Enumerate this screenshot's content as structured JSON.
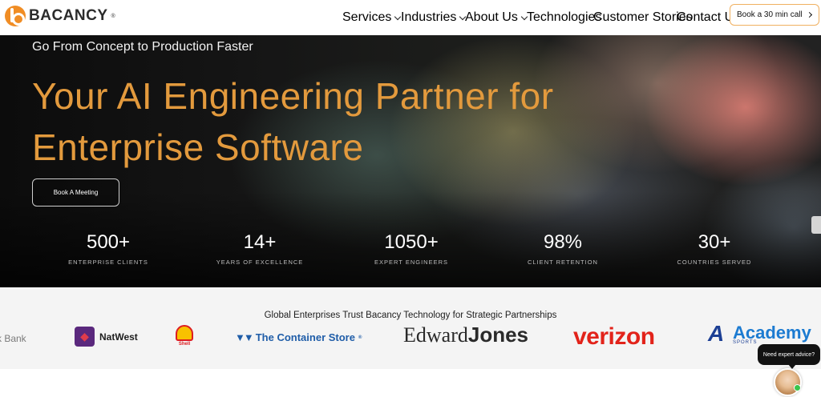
{
  "brand": {
    "name": "BACANCY",
    "registered_mark": "®",
    "accent_color": "#f08d25"
  },
  "nav": {
    "items": [
      {
        "label": "Services",
        "has_dropdown": true
      },
      {
        "label": "Industries",
        "has_dropdown": true
      },
      {
        "label": "About Us",
        "has_dropdown": true
      },
      {
        "label": "Technologies",
        "has_dropdown": false
      },
      {
        "label": "Customer Stories",
        "has_dropdown": false
      },
      {
        "label": "Contact Us",
        "has_dropdown": false
      }
    ],
    "cta_label": "Book a 30 min call"
  },
  "hero": {
    "eyebrow": "Go From Concept to Production Faster",
    "headline_line1": "Your AI Engineering Partner for",
    "headline_line2": "Enterprise Software",
    "headline_color": "#e39a3d",
    "button_label": "Book A Meeting",
    "stats": [
      {
        "value": "500+",
        "label": "ENTERPRISE CLIENTS"
      },
      {
        "value": "14+",
        "label": "YEARS OF EXCELLENCE"
      },
      {
        "value": "1050+",
        "label": "EXPERT ENGINEERS"
      },
      {
        "value": "98%",
        "label": "CLIENT RETENTION"
      },
      {
        "value": "30+",
        "label": "COUNTRIES SERVED"
      }
    ]
  },
  "trust": {
    "title": "Global Enterprises Trust Bacancy Technology for Strategic Partnerships",
    "logos": {
      "bank": "k Bank",
      "natwest": "NatWest",
      "shell": "Shell",
      "container_store": "The Container Store",
      "container_store_reg": "®",
      "edward": "Edward",
      "jones": "Jones",
      "verizon": "verizon",
      "academy": "Academy",
      "academy_sub": "SPORTS"
    }
  },
  "chat": {
    "bubble_text": "Need expert advice?"
  }
}
